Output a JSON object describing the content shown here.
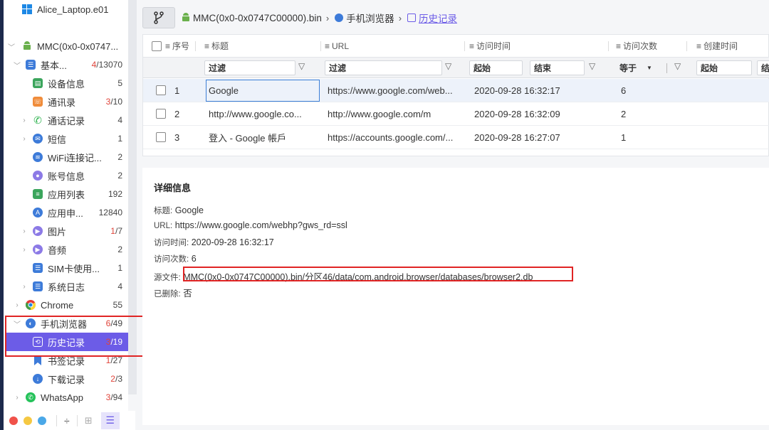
{
  "device": {
    "name": "Alice_Laptop.e01"
  },
  "tree": [
    {
      "label": "MMC(0x0-0x0747...",
      "count": "",
      "red": ""
    },
    {
      "label": "基本...",
      "count": "/13070",
      "red": "4"
    },
    {
      "label": "设备信息",
      "count": "5",
      "red": ""
    },
    {
      "label": "通讯录",
      "count": "/10",
      "red": "3"
    },
    {
      "label": "通话记录",
      "count": "4",
      "red": ""
    },
    {
      "label": "短信",
      "count": "1",
      "red": ""
    },
    {
      "label": "WiFi连接记...",
      "count": "2",
      "red": ""
    },
    {
      "label": "账号信息",
      "count": "2",
      "red": ""
    },
    {
      "label": "应用列表",
      "count": "192",
      "red": ""
    },
    {
      "label": "应用申...",
      "count": "12840",
      "red": ""
    },
    {
      "label": "图片",
      "count": "/7",
      "red": "1"
    },
    {
      "label": "音频",
      "count": "2",
      "red": ""
    },
    {
      "label": "SIM卡使用...",
      "count": "1",
      "red": ""
    },
    {
      "label": "系统日志",
      "count": "4",
      "red": ""
    },
    {
      "label": "Chrome",
      "count": "55",
      "red": ""
    },
    {
      "label": "手机浏览器",
      "count": "/49",
      "red": "6"
    },
    {
      "label": "历史记录",
      "count": "/19",
      "red": "3"
    },
    {
      "label": "书签记录",
      "count": "/27",
      "red": "1"
    },
    {
      "label": "下载记录",
      "count": "/3",
      "red": "2"
    },
    {
      "label": "WhatsApp",
      "count": "/94",
      "red": "3"
    }
  ],
  "breadcrumb": {
    "device": "MMC(0x0-0x0747C00000).bin",
    "browser": "手机浏览器",
    "history": "历史记录"
  },
  "columns": {
    "seq": "序号",
    "title": "标题",
    "url": "URL",
    "visit_time": "访问时间",
    "visit_count": "访问次数",
    "created": "创建时间"
  },
  "filters": {
    "title": "过滤",
    "url": "过滤",
    "start": "起始",
    "end": "结束",
    "op": "等于",
    "created_start": "起始",
    "created_end": "结"
  },
  "rows": [
    {
      "no": "1",
      "title": "Google",
      "url": "https://www.google.com/web...",
      "time": "2020-09-28 16:32:17",
      "count": "6"
    },
    {
      "no": "2",
      "title": "http://www.google.co...",
      "url": "http://www.google.com/m",
      "time": "2020-09-28 16:32:09",
      "count": "2"
    },
    {
      "no": "3",
      "title": "登入 - Google 帳戶",
      "url": "https://accounts.google.com/...",
      "time": "2020-09-28 16:27:07",
      "count": "1"
    }
  ],
  "detail": {
    "heading": "详细信息",
    "title_k": "标题:",
    "title_v": "Google",
    "url_k": "URL:",
    "url_v": "https://www.google.com/webhp?gws_rd=ssl",
    "time_k": "访问时间:",
    "time_v": "2020-09-28 16:32:17",
    "count_k": "访问次数:",
    "count_v": "6",
    "src_k": "源文件:",
    "src_v": "MMC(0x0-0x0747C00000).bin/分区46/data/com.android.browser/databases/browser2.db",
    "del_k": "已删除:",
    "del_v": "否"
  },
  "colors": {
    "accent": "#6c5ce7",
    "highlight": "#e02424"
  }
}
